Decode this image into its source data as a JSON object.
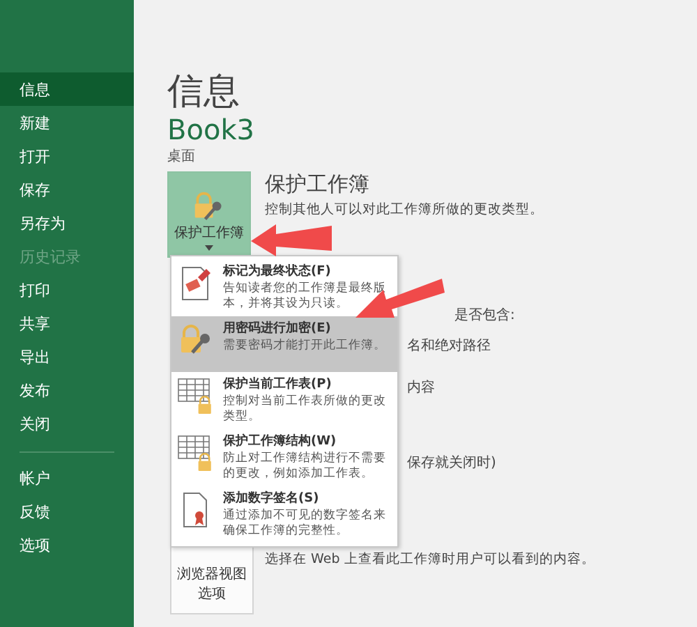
{
  "sidebar": {
    "items": [
      {
        "label": "信息",
        "selected": true,
        "disabled": false
      },
      {
        "label": "新建",
        "selected": false,
        "disabled": false
      },
      {
        "label": "打开",
        "selected": false,
        "disabled": false
      },
      {
        "label": "保存",
        "selected": false,
        "disabled": false
      },
      {
        "label": "另存为",
        "selected": false,
        "disabled": false
      },
      {
        "label": "历史记录",
        "selected": false,
        "disabled": true
      },
      {
        "label": "打印",
        "selected": false,
        "disabled": false
      },
      {
        "label": "共享",
        "selected": false,
        "disabled": false
      },
      {
        "label": "导出",
        "selected": false,
        "disabled": false
      },
      {
        "label": "发布",
        "selected": false,
        "disabled": false
      },
      {
        "label": "关闭",
        "selected": false,
        "disabled": false
      }
    ],
    "bottom_items": [
      {
        "label": "帐户",
        "selected": false
      },
      {
        "label": "反馈",
        "selected": false
      },
      {
        "label": "选项",
        "selected": false
      }
    ]
  },
  "page_title": "信息",
  "workbook": {
    "name": "Book3",
    "location": "桌面"
  },
  "protect": {
    "button": "保护工作簿",
    "heading": "保护工作簿",
    "description": "控制其他人可以对此工作簿所做的更改类型。"
  },
  "background_lines": [
    "是否包含:",
    "名和绝对路径",
    "内容",
    "保存就关闭时)"
  ],
  "browser_view": {
    "button": "浏览器视图选项",
    "description": "选择在 Web 上查看此工作簿时用户可以看到的内容。"
  },
  "menu": [
    {
      "kind": "final",
      "title": "标记为最终状态(F)",
      "description": "告知读者您的工作簿是最终版本，并将其设为只读。",
      "selected": false
    },
    {
      "kind": "password",
      "title": "用密码进行加密(E)",
      "description": "需要密码才能打开此工作簿。",
      "selected": true
    },
    {
      "kind": "sheet",
      "title": "保护当前工作表(P)",
      "description": "控制对当前工作表所做的更改类型。",
      "selected": false
    },
    {
      "kind": "structure",
      "title": "保护工作簿结构(W)",
      "description": "防止对工作簿结构进行不需要的更改，例如添加工作表。",
      "selected": false
    },
    {
      "kind": "signature",
      "title": "添加数字签名(S)",
      "description": "通过添加不可见的数字签名来确保工作簿的完整性。",
      "selected": false
    }
  ]
}
